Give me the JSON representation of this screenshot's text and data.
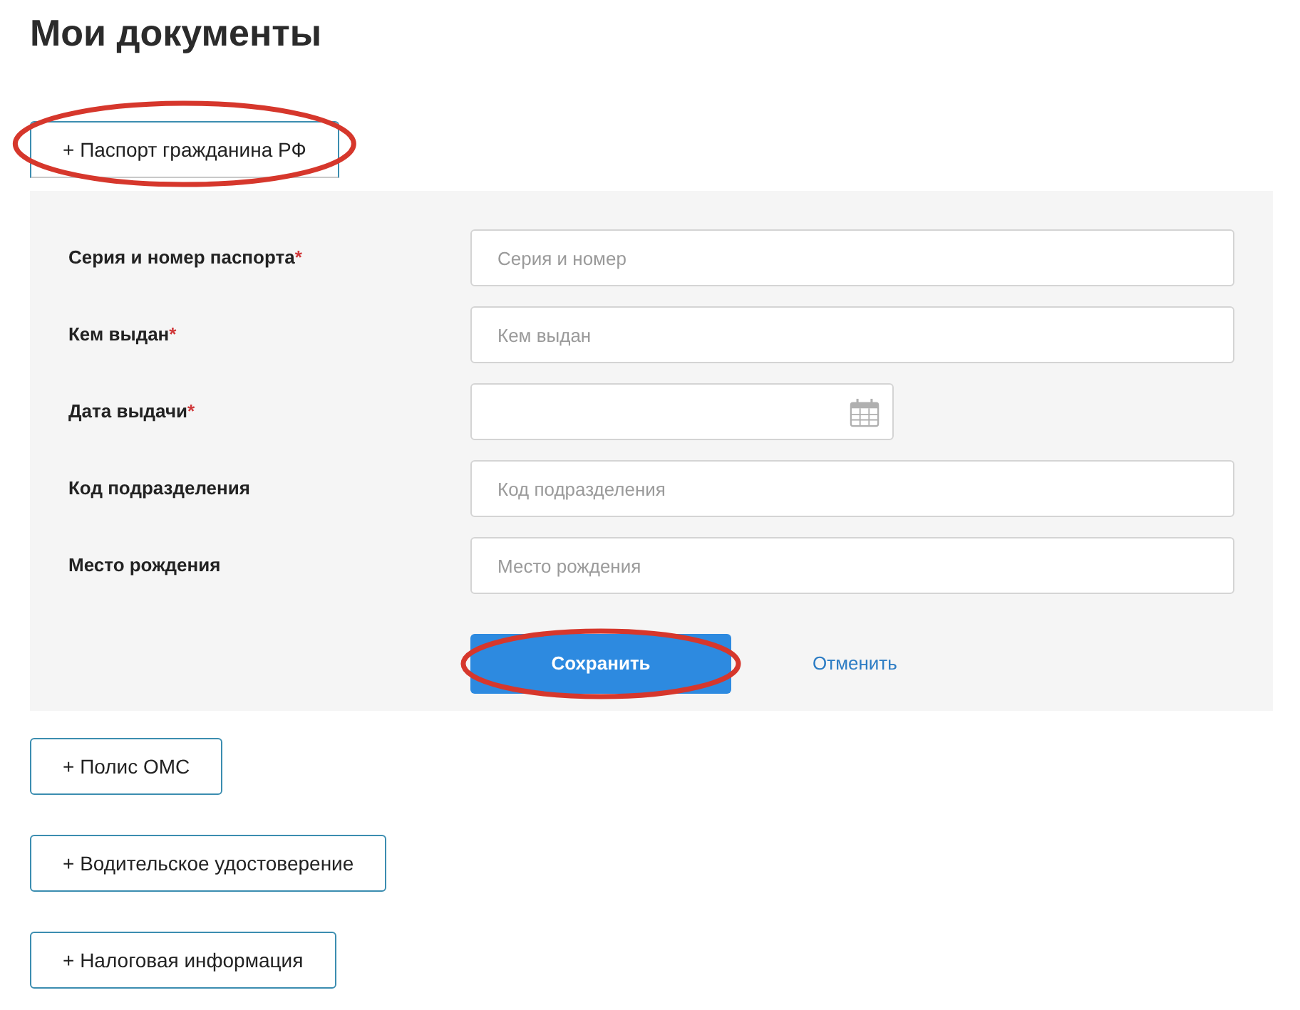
{
  "page": {
    "title": "Мои документы"
  },
  "documents": [
    {
      "label": "+ Паспорт гражданина РФ",
      "expanded": true,
      "highlighted": true,
      "form": {
        "fields": [
          {
            "kind": "text",
            "label": "Серия и номер паспорта",
            "required_mark": "*",
            "placeholder": "Серия и номер"
          },
          {
            "kind": "text",
            "label": "Кем выдан",
            "required_mark": "*",
            "placeholder": "Кем выдан"
          },
          {
            "kind": "date",
            "label": "Дата выдачи",
            "required_mark": "*"
          },
          {
            "kind": "text",
            "label": "Код подразделения",
            "placeholder": "Код подразделения"
          },
          {
            "kind": "text",
            "label": "Место рождения",
            "placeholder": "Место рождения"
          }
        ],
        "save": {
          "label": "Сохранить",
          "highlighted": true
        },
        "cancel": {
          "label": "Отменить"
        }
      }
    },
    {
      "label": "+ Полис ОМС",
      "expanded": false,
      "highlighted": false
    },
    {
      "label": "+ Водительское удостоверение",
      "expanded": false,
      "highlighted": false
    },
    {
      "label": "+ Налоговая информация",
      "expanded": false,
      "highlighted": false
    }
  ]
}
